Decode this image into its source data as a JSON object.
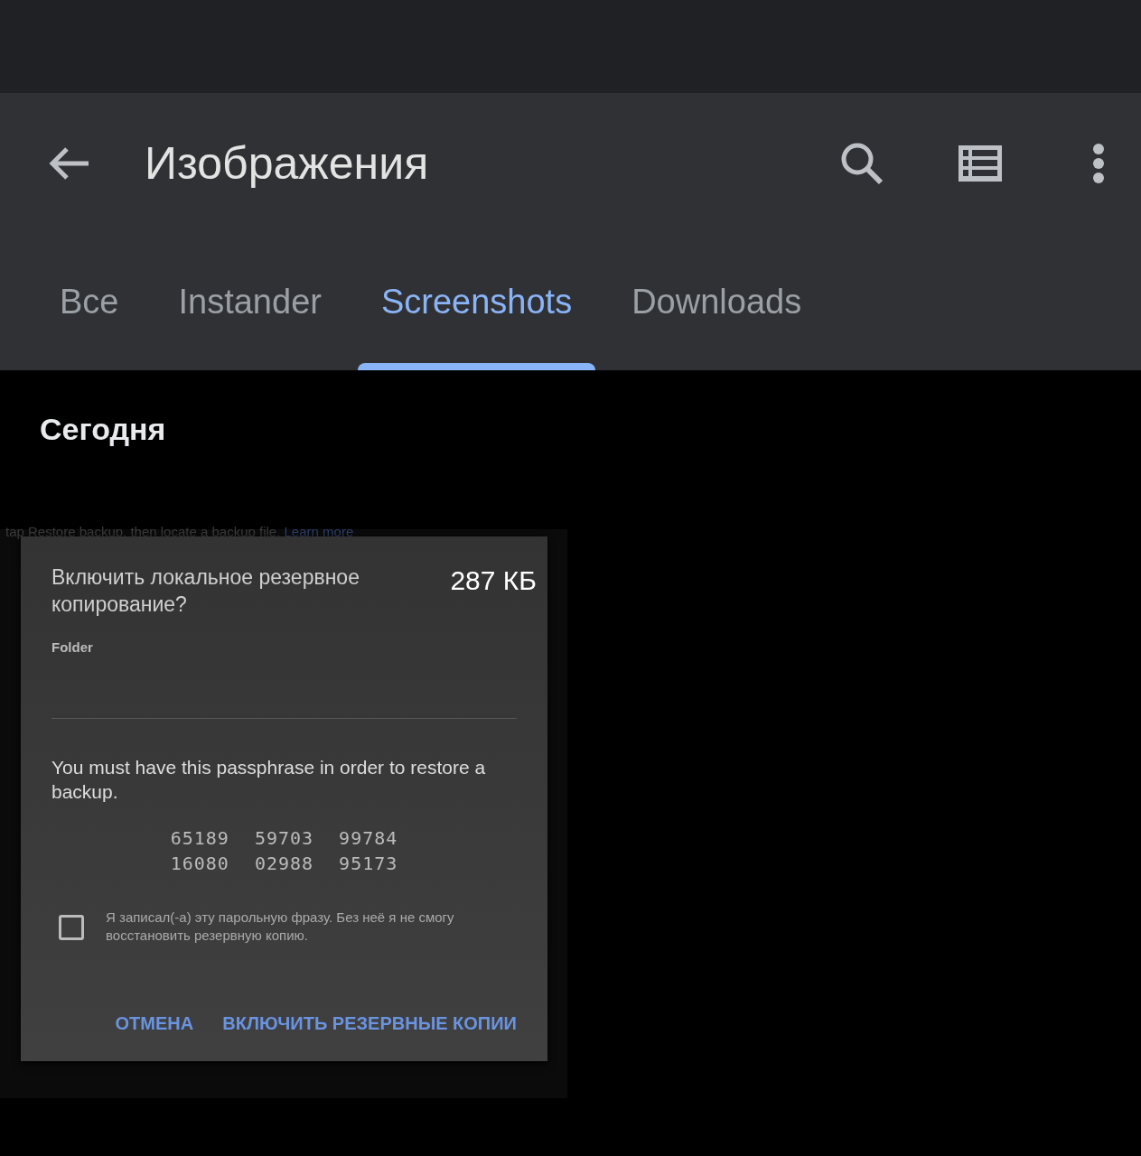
{
  "app_bar": {
    "title": "Изображения"
  },
  "tabs": [
    {
      "label": "Все",
      "selected": false
    },
    {
      "label": "Instander",
      "selected": false
    },
    {
      "label": "Screenshots",
      "selected": true
    },
    {
      "label": "Downloads",
      "selected": false
    }
  ],
  "section": {
    "heading": "Сегодня"
  },
  "thumbnail": {
    "size": "287 КБ",
    "behind_text": "tap Restore backup, then locate a backup file.",
    "behind_link": "Learn more",
    "dialog": {
      "title": "Включить локальное резервное копирование?",
      "field_label": "Folder",
      "message": "You must have this passphrase in order to restore a backup.",
      "passphrase": [
        [
          "65189",
          "59703",
          "99784"
        ],
        [
          "16080",
          "02988",
          "95173"
        ]
      ],
      "confirm": {
        "label": "Я записал(-а) эту парольную фразу. Без неё я не смогу восстановить резервную копию.",
        "checked": false
      },
      "buttons": [
        "ОТМЕНА",
        "ВКЛЮЧИТЬ РЕЗЕРВНЫЕ КОПИИ"
      ]
    }
  }
}
